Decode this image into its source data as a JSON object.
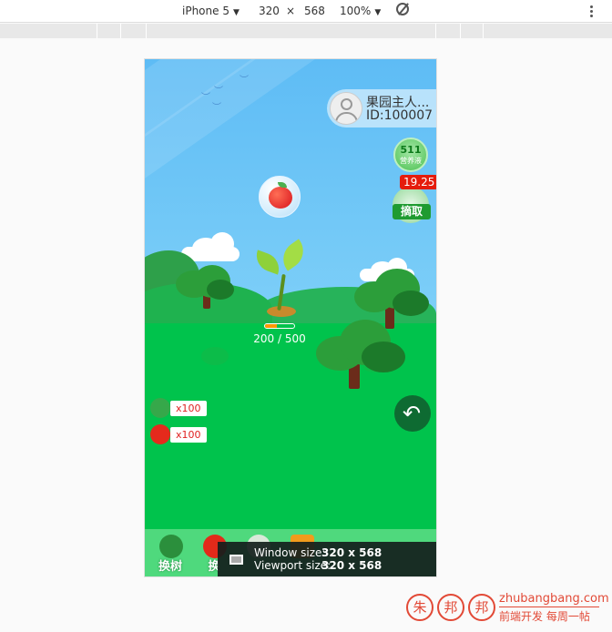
{
  "devtools": {
    "device": "iPhone 5",
    "width": "320",
    "times": "×",
    "height": "568",
    "zoom": "100%",
    "caret": "▼"
  },
  "game": {
    "profile": {
      "name": "果园主人...",
      "id": "ID:100007"
    },
    "nutrient": {
      "value": "511",
      "label": "营养液"
    },
    "pick": {
      "badge": "19.25",
      "label": "摘取"
    },
    "growth": {
      "text": "200 / 500",
      "fraction": 0.4
    },
    "inventory": [
      {
        "icon": "tree-icon",
        "count": "x100"
      },
      {
        "icon": "apple-icon",
        "count": "x100"
      }
    ],
    "bottom_tabs": [
      {
        "icon": "tree-icon",
        "label": "换树"
      },
      {
        "icon": "apple-icon",
        "label": "换"
      },
      {
        "icon": "coin-icon",
        "label": ""
      },
      {
        "icon": "book-icon",
        "label": ""
      }
    ],
    "back_icon": "back-arrow-icon"
  },
  "overlay": {
    "window_label": "Window size:",
    "window_value": "320 x 568",
    "viewport_label": "Viewport size:",
    "viewport_value": "320 x 568"
  },
  "watermark": {
    "seal": [
      "朱",
      "邦",
      "邦"
    ],
    "site": "zhubangbang.com",
    "slogan": "前端开发  每周一帖"
  },
  "colors": {
    "sky": "#5ebcf5",
    "grass": "#00c34c",
    "accent_red": "#e51c0c",
    "button_green": "#1f9b31"
  }
}
